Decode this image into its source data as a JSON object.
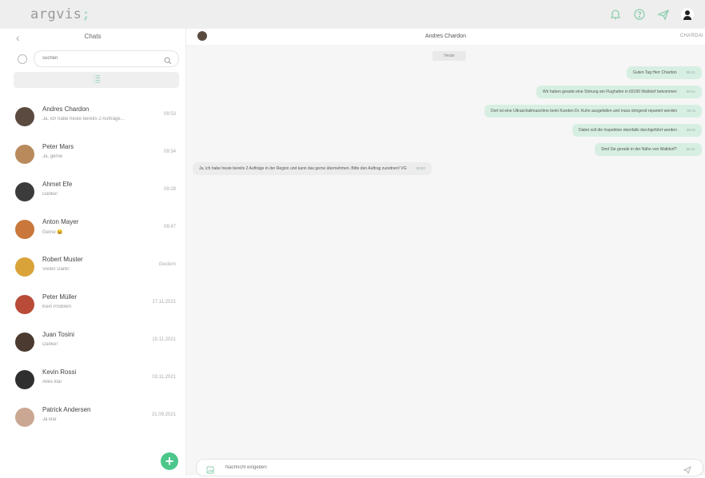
{
  "app": {
    "logo_text": "argvis",
    "logo_suffix": ";",
    "top_icons": [
      "bell-icon",
      "help-icon",
      "send-icon",
      "user-avatar"
    ]
  },
  "sidebar": {
    "back_icon": "chevron-left-icon",
    "title": "Chats",
    "search_placeholder": "suchen",
    "filter_icon": "list-filter-icon",
    "add_icon": "plus-icon",
    "chats": [
      {
        "name": "Andres Chardon",
        "preview": "Ja, ich habe heute bereits 2 Aufträge...",
        "time": "09:53",
        "avatar_color": "#5a4a3f"
      },
      {
        "name": "Peter Mars",
        "preview": "Ja, gerne",
        "time": "09:34",
        "avatar_color": "#b88a5c"
      },
      {
        "name": "Ahmet Efe",
        "preview": "Danke!",
        "time": "09:28",
        "avatar_color": "#3b3b3b"
      },
      {
        "name": "Anton Mayer",
        "preview": "Gerne 😀",
        "time": "08:47",
        "avatar_color": "#c9773a"
      },
      {
        "name": "Robert Muster",
        "preview": "Vielen Dank!",
        "time": "Gestern",
        "avatar_color": "#d9a33a"
      },
      {
        "name": "Peter Müller",
        "preview": "Kein Problem",
        "time": "17.11.2021",
        "avatar_color": "#b94b38"
      },
      {
        "name": "Juan Tosini",
        "preview": "Danke!",
        "time": "15.11.2021",
        "avatar_color": "#4a3a30"
      },
      {
        "name": "Kevin Rossi",
        "preview": "Alles klar",
        "time": "03.11.2021",
        "avatar_color": "#2f2f2f"
      },
      {
        "name": "Patrick Andersen",
        "preview": "Ja klar",
        "time": "21.09.2021",
        "avatar_color": "#caa792"
      }
    ]
  },
  "chat": {
    "title": "Andres Chardon",
    "right_label": "CHARDAI",
    "date_label": "Heute",
    "messages": [
      {
        "dir": "out",
        "text": "Guten Tag Herr Chardon",
        "time": "09:41"
      },
      {
        "dir": "out",
        "text": "Wir haben gerade eine Störung am Flughafen in 69190 Walldorf bekommen",
        "time": "09:41"
      },
      {
        "dir": "out",
        "text": "Dort ist eine Ultraschallmaschine beim Kunden Dr. Kuhn ausgefallen und muss dringend repariert werden",
        "time": "09:41"
      },
      {
        "dir": "out",
        "text": "Dabei soll die Inspektion ebenfalls durchgeführt werden",
        "time": "09:41"
      },
      {
        "dir": "out",
        "text": "Sind Sie gerade in der Nähe von Walldorf?",
        "time": "09:41"
      },
      {
        "dir": "in",
        "text": "Ja, ich habe heute bereits 2 Aufträge in der Region und kann das gerne übernehmen. Bitte den Auftrag zuordnen! VG",
        "time": "09:53"
      }
    ],
    "composer_placeholder": "Nachricht eingeben",
    "composer_image_icon": "image-icon",
    "composer_send_icon": "send-icon"
  },
  "colors": {
    "accent": "#4cc68a",
    "outgoing_bubble": "#d7efe2",
    "incoming_bubble": "#ececec"
  }
}
